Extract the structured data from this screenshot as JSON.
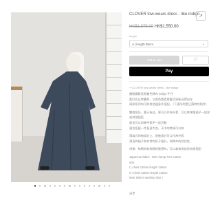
{
  "product": {
    "title": "CLOVER tow-wears dress - like indigo",
    "old_price": "HK$1,875.00",
    "price": "HK$1,550.00",
    "length_label": "length",
    "selected_option": "A | length 98cm",
    "add_to_cart_label": "add to cart",
    "apple_pay_label": "Pay",
    "description_toggle": "+  CLOVER tow-wears dress - like indigo",
    "description": [
      "優雅寬鬆長款雙色棉布 indigo 牛仔",
      "藍好比日常觸到，以兩色營造更靈活清新自得自在",
      "兩款系列均可與其他連身外搭配，（下面所附是日落時的照片）",
      "雙肩設計，夏天為佳，更可以作為外套，可以拿來跟裙子一起穿或其他配搭",
      "創造可以與幾乎裙子一起活動",
      "適合搭配一件長身大衣，天冷的時候可以穿",
      "落肩式的袖設計上，前後設計可以作為外套",
      "漂亮的袖子和非常的扣子設計，與棉布的對比性，",
      "材質：純棉與有純棉的質感布，可以拿來與其他衣服搭配",
      "Japanese fabric : 28% hemp 72% cotton",
      "size",
      "I | chest 120cm length 126cm",
      "II | chest 126cm length 116cm",
      "Man 186cm wearing size I"
    ],
    "share_label": "分享"
  },
  "gallery": {
    "dot_count": 16,
    "active_dot": 0
  },
  "colors": {
    "dress": "#3c4a5c",
    "apple_pay_bg": "#000000",
    "add_to_cart_bg": "#d7d7d7"
  },
  "icons": {
    "wishlist": "heart-icon",
    "share": "share-icon",
    "more": "more-icon"
  }
}
